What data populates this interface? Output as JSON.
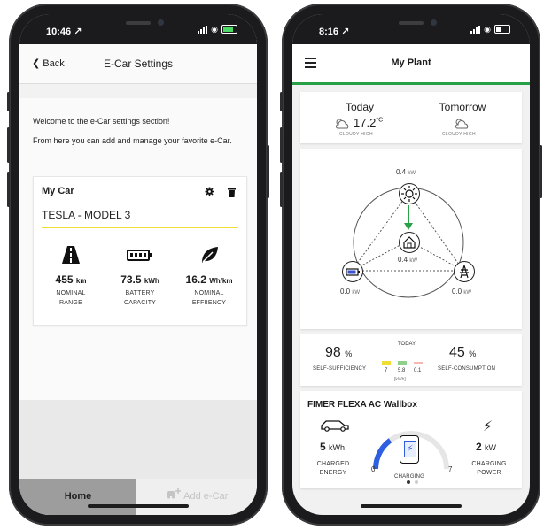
{
  "left_phone": {
    "status": {
      "time": "10:46 ↗"
    },
    "nav": {
      "back_label": "Back",
      "title": "E-Car Settings"
    },
    "welcome_text": "Welcome to the e-Car settings section!",
    "intro_text": "From here you can add and manage your favorite e-Car.",
    "car_card": {
      "title": "My Car",
      "model": "TESLA - MODEL 3",
      "accent": "#f0de34",
      "stats": [
        {
          "icon": "road-icon",
          "value": "455",
          "unit": "km",
          "label_1": "NOMINAL",
          "label_2": "RANGE"
        },
        {
          "icon": "battery-icon",
          "value": "73.5",
          "unit": "kWh",
          "label_1": "BATTERY",
          "label_2": "CAPACITY"
        },
        {
          "icon": "leaf-icon",
          "value": "16.2",
          "unit": "Wh/km",
          "label_1": "NOMINAL",
          "label_2": "EFFIIENCY"
        }
      ]
    },
    "tabs": {
      "home": "Home",
      "add": "Add e-Car"
    }
  },
  "right_phone": {
    "status": {
      "time": "8:16 ↗"
    },
    "nav": {
      "title": "My Plant"
    },
    "weather": {
      "today": {
        "label": "Today",
        "temp": "17.2",
        "unit": "°C",
        "desc": "CLOUDY HIGH"
      },
      "tomorrow": {
        "label": "Tomorrow",
        "desc": "CLOUDY HIGH"
      }
    },
    "flow": {
      "solar": {
        "value": "0.4",
        "unit": "kW"
      },
      "home": {
        "value": "0.4",
        "unit": "kW"
      },
      "battery": {
        "value": "0.0",
        "unit": "kW"
      },
      "grid": {
        "value": "0.0",
        "unit": "kW"
      },
      "accent": "#27a046"
    },
    "summary": {
      "self_sufficiency": {
        "value": "98",
        "unit": "%",
        "label": "SELF-SUFFICIENCY"
      },
      "self_consumption": {
        "value": "45",
        "unit": "%",
        "label": "SELF-CONSUMPTION"
      },
      "today_label": "TODAY",
      "bars": [
        {
          "value": "7",
          "color": "#f0de34"
        },
        {
          "value": "5.8",
          "color": "#8fd18a"
        },
        {
          "value": "0.1",
          "color": "#f5b7b1"
        }
      ],
      "unit": "[kWh]"
    },
    "wallbox": {
      "title": "FIMER FLEXA AC Wallbox",
      "energy": {
        "value": "5",
        "unit": "kWh",
        "label_1": "CHARGED",
        "label_2": "ENERGY"
      },
      "gauge": {
        "min": "0",
        "max": "7",
        "status": "CHARGING",
        "level": 0.3
      },
      "power": {
        "value": "2",
        "unit": "kW",
        "label_1": "CHARGING",
        "label_2": "POWER"
      }
    }
  }
}
